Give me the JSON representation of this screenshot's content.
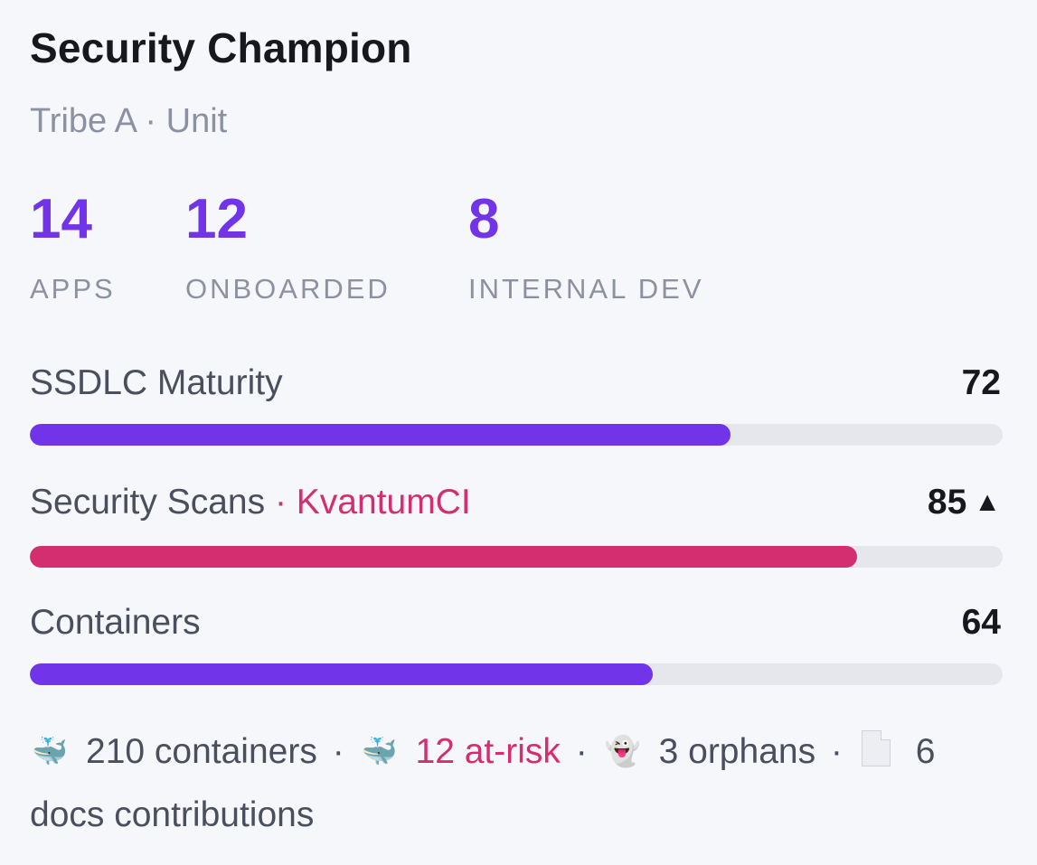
{
  "card": {
    "title": "Security Champion",
    "subtitle": "Tribe A · Unit"
  },
  "stats": [
    {
      "value": "14",
      "label": "APPS"
    },
    {
      "value": "12",
      "label": "ONBOARDED"
    },
    {
      "value": "8",
      "label": "INTERNAL DEV"
    }
  ],
  "metrics": {
    "ssdlc": {
      "name": "SSDLC Maturity",
      "value": "72",
      "progress": 0.72,
      "color": "#7234e8"
    },
    "scans": {
      "name": "Security Scans",
      "separator": " · ",
      "tool": "KvantumCI",
      "value": "85",
      "trend": "▲",
      "progress": 0.85,
      "color": "#d42d70"
    },
    "containers": {
      "name": "Containers",
      "value": "64",
      "progress": 0.64,
      "color": "#7234e8"
    }
  },
  "footer": {
    "containers_icon": "whale-icon",
    "containers_text": "210 containers",
    "risk_icon": "whale-icon",
    "risk_text": "12 at-risk",
    "orphans_icon": "ghost-icon",
    "orphans_text": "3 orphans",
    "docs_icon": "document-icon",
    "docs_text": "6 docs contributions",
    "separator": "·"
  },
  "colors": {
    "accent": "#7234e8",
    "alert": "#d42d70",
    "track": "#e6e7ed",
    "muted": "#8b91a1"
  }
}
